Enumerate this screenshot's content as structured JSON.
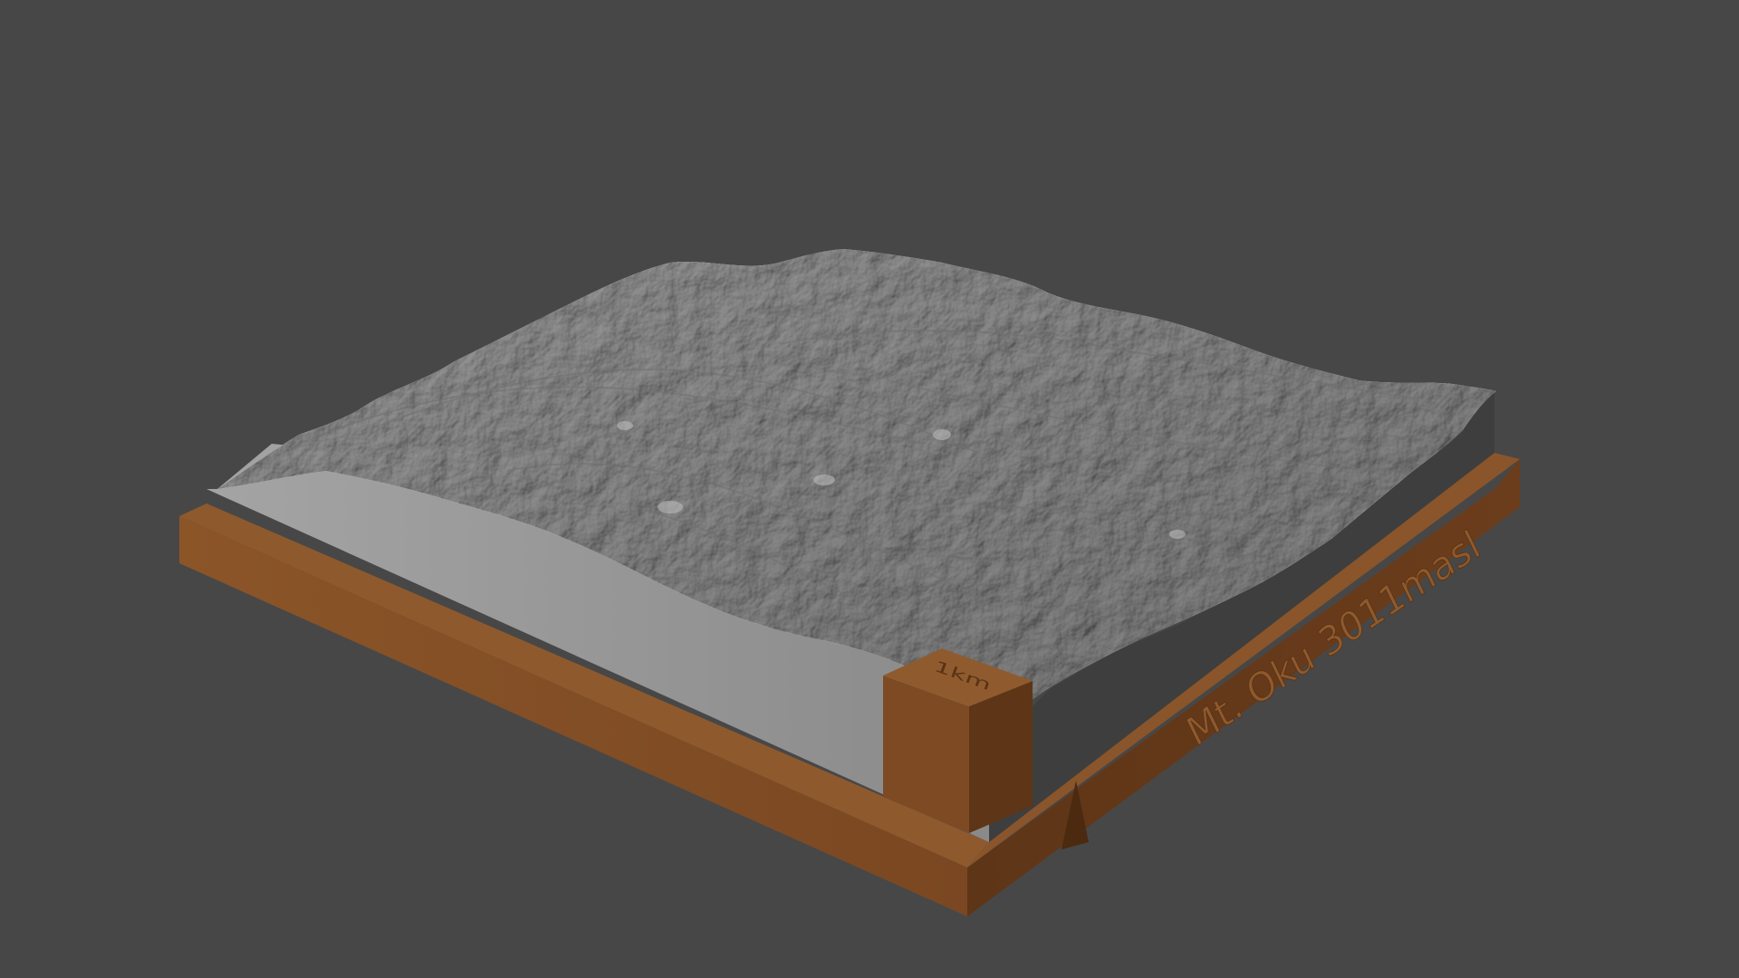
{
  "scene": {
    "background_color": "#474747",
    "base_color": "#7a4a26",
    "terrain_color": "#8f8f8f",
    "terrain_side_color": "#9a9a9a",
    "label_text": "Mt. Oku 3011masl",
    "scale_marker_text": "1km"
  }
}
